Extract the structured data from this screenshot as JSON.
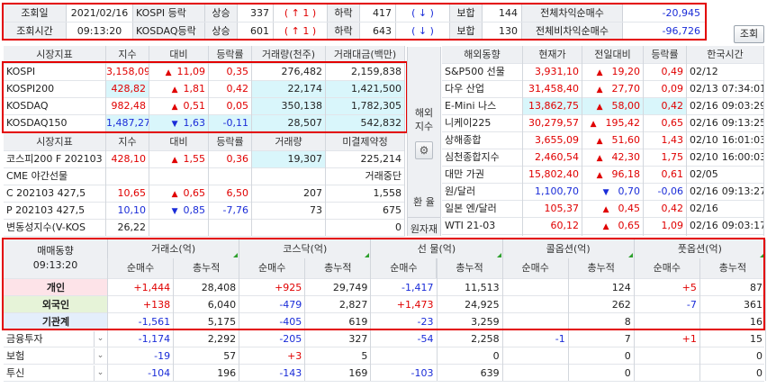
{
  "top": {
    "row1": {
      "date_label": "조회일",
      "date_value": "2021/02/16",
      "market": "KOSPI 등락",
      "up_label": "상승",
      "up_value": "337",
      "up_paren": "( ↑   1 )",
      "down_label": "하락",
      "down_value": "417",
      "down_paren": "( ↓   )",
      "flat_label": "보합",
      "flat_value": "144",
      "net_label": "전체차익순매수",
      "net_value": "-20,945"
    },
    "row2": {
      "time_label": "조회시간",
      "time_value": "09:13:20",
      "market": "KOSDAQ등락",
      "up_label": "상승",
      "up_value": "601",
      "up_paren": "( ↑   1 )",
      "down_label": "하락",
      "down_value": "643",
      "down_paren": "( ↓   )",
      "flat_label": "보합",
      "flat_value": "130",
      "net_label": "전체비차익순매수",
      "net_value": "-96,726"
    },
    "query_button": "조회"
  },
  "left": {
    "headers": [
      "시장지표",
      "지수",
      "대비",
      "등락률",
      "거래량(천주)",
      "거래대금(백만)"
    ],
    "rows": [
      {
        "name": "KOSPI",
        "idx": "3,158,09",
        "dir": "▲",
        "chg": "11,09",
        "rate": "0,35",
        "vol": "276,482",
        "amt": "2,159,838"
      },
      {
        "name": "KOSPI200",
        "idx": "428,82",
        "dir": "▲",
        "chg": "1,81",
        "rate": "0,42",
        "vol": "22,174",
        "amt": "1,421,500"
      },
      {
        "name": "KOSDAQ",
        "idx": "982,48",
        "dir": "▲",
        "chg": "0,51",
        "rate": "0,05",
        "vol": "350,138",
        "amt": "1,782,305"
      },
      {
        "name": "KOSDAQ150",
        "idx": "1,487,27",
        "dir": "▼",
        "chg": "1,63",
        "rate": "-0,11",
        "vol": "28,507",
        "amt": "542,832"
      }
    ],
    "headers2": [
      "시장지표",
      "지수",
      "대비",
      "등락률",
      "거래량",
      "미결제약정"
    ],
    "rows2": [
      {
        "name": "코스피200 F 202103",
        "idx": "428,10",
        "dir": "▲",
        "chg": "1,55",
        "rate": "0,36",
        "vol": "19,307",
        "amt": "225,214"
      },
      {
        "name": "CME 야간선물",
        "idx": "",
        "dir": "",
        "chg": "",
        "rate": "",
        "vol": "",
        "amt": "거래중단"
      },
      {
        "name": "C 202103 427,5",
        "idx": "10,65",
        "dir": "▲",
        "chg": "0,65",
        "rate": "6,50",
        "vol": "207",
        "amt": "1,558"
      },
      {
        "name": "P 202103 427,5",
        "idx": "10,10",
        "dir": "▼",
        "chg": "0,85",
        "rate": "-7,76",
        "vol": "73",
        "amt": "675"
      },
      {
        "name": "변동성지수(V-KOS",
        "idx": "26,22",
        "dir": "",
        "chg": "",
        "rate": "",
        "vol": "",
        "amt": "0"
      }
    ]
  },
  "middle": {
    "overseas": "해외\n지수",
    "fx": "환   율",
    "commodity": "원자재"
  },
  "right": {
    "headers": [
      "해외동향",
      "현재가",
      "전일대비",
      "등락률",
      "한국시간"
    ],
    "rows": [
      {
        "name": "S&P500 선물",
        "price": "3,931,10",
        "dir": "▲",
        "chg": "19,20",
        "rate": "0,49",
        "date": "02/12",
        "time": ""
      },
      {
        "name": "다우 산업",
        "price": "31,458,40",
        "dir": "▲",
        "chg": "27,70",
        "rate": "0,09",
        "date": "02/13",
        "time": "07:34:01"
      },
      {
        "name": "E-Mini 나스",
        "price": "13,862,75",
        "dir": "▲",
        "chg": "58,00",
        "rate": "0,42",
        "date": "02/16",
        "time": "09:03:29"
      },
      {
        "name": "니케이225",
        "price": "30,279,57",
        "dir": "▲",
        "chg": "195,42",
        "rate": "0,65",
        "date": "02/16",
        "time": "09:13:25"
      },
      {
        "name": "상해종합",
        "price": "3,655,09",
        "dir": "▲",
        "chg": "51,60",
        "rate": "1,43",
        "date": "02/10",
        "time": "16:01:03"
      },
      {
        "name": "심천종합지수",
        "price": "2,460,54",
        "dir": "▲",
        "chg": "42,30",
        "rate": "1,75",
        "date": "02/10",
        "time": "16:00:03"
      },
      {
        "name": "대만 가권",
        "price": "15,802,40",
        "dir": "▲",
        "chg": "96,18",
        "rate": "0,61",
        "date": "02/05",
        "time": ""
      },
      {
        "name": "원/달러",
        "price": "1,100,70",
        "dir": "▼",
        "chg": "0,70",
        "rate": "-0,06",
        "date": "02/16",
        "time": "09:13:27"
      },
      {
        "name": "일본 엔/달러",
        "price": "105,37",
        "dir": "▲",
        "chg": "0,45",
        "rate": "0,42",
        "date": "02/16",
        "time": ""
      },
      {
        "name": "WTI 21-03",
        "price": "60,12",
        "dir": "▲",
        "chg": "0,65",
        "rate": "1,09",
        "date": "02/16",
        "time": "09:03:17"
      }
    ]
  },
  "bottom": {
    "title": "매매동향",
    "time": "09:13:20",
    "groups": [
      "거래소(억)",
      "코스닥(억)",
      "선   물(억)",
      "콜옵션(억)",
      "풋옵션(억)"
    ],
    "sub": [
      "순매수",
      "총누적"
    ],
    "rows": [
      {
        "name": "개인",
        "v": [
          "+1,444",
          "28,408",
          "+925",
          "29,749",
          "-1,417",
          "11,513",
          "",
          "124",
          "+5",
          "87"
        ]
      },
      {
        "name": "외국인",
        "v": [
          "+138",
          "6,040",
          "-479",
          "2,827",
          "+1,473",
          "24,925",
          "",
          "262",
          "-7",
          "361"
        ]
      },
      {
        "name": "기관계",
        "v": [
          "-1,561",
          "5,175",
          "-405",
          "619",
          "-23",
          "3,259",
          "",
          "8",
          "",
          "16"
        ]
      },
      {
        "name": "금융투자",
        "v": [
          "-1,174",
          "2,292",
          "-205",
          "327",
          "-54",
          "2,258",
          "-1",
          "7",
          "+1",
          "15"
        ]
      },
      {
        "name": "보험",
        "v": [
          "-19",
          "57",
          "+3",
          "5",
          "",
          "0",
          "",
          "0",
          "",
          "0"
        ]
      },
      {
        "name": "투신",
        "v": [
          "-104",
          "196",
          "-143",
          "169",
          "-103",
          "639",
          "",
          "0",
          "",
          "0"
        ]
      }
    ]
  }
}
